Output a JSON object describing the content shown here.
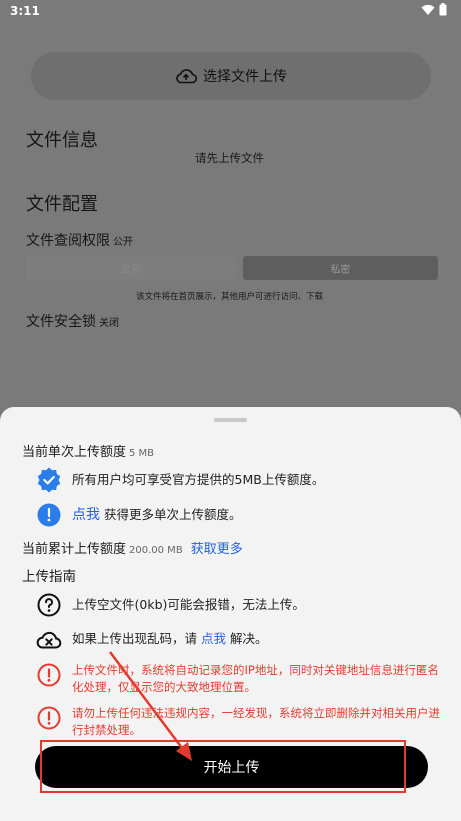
{
  "status_bar": {
    "time": "3:11"
  },
  "page": {
    "upload_button": "选择文件上传",
    "file_info": {
      "title": "文件信息",
      "empty_hint": "请先上传文件"
    },
    "file_config": {
      "title": "文件配置",
      "view_permission": {
        "label": "文件查阅权限",
        "value": "公开",
        "options": [
          "公开",
          "私密"
        ],
        "hint": "该文件将在首页展示，其他用户可进行访问、下载"
      },
      "security_lock": {
        "label": "文件安全锁",
        "value": "关闭"
      }
    }
  },
  "sheet": {
    "single_quota": {
      "label": "当前单次上传额度",
      "value": "5 MB"
    },
    "official_note": "所有用户均可享受官方提供的5MB上传额度。",
    "get_more_single": {
      "link": "点我",
      "text": "获得更多单次上传额度。"
    },
    "total_quota": {
      "label": "当前累计上传额度",
      "value": "200.00 MB",
      "link": "获取更多"
    },
    "guide_title": "上传指南",
    "guide": {
      "empty_file": "上传空文件(0kb)可能会报错，无法上传。",
      "garbled_prefix": "如果上传出现乱码，请",
      "garbled_link": "点我",
      "garbled_suffix": "解决。",
      "ip_warning": "上传文件时，系统将自动记录您的IP地址，同时对关键地址信息进行匿名化处理，仅显示您的大致地理位置。",
      "violation_warning": "请勿上传任何违法违规内容，一经发现，系统将立即删除并对相关用户进行封禁处理。"
    },
    "start_button": "开始上传"
  },
  "colors": {
    "link": "#2563d8",
    "warning": "#e63b2e",
    "badge": "#2b7de9",
    "button": "#000000"
  }
}
